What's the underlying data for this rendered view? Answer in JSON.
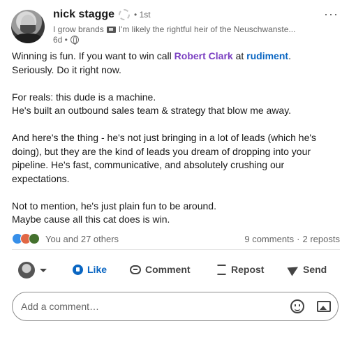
{
  "author": {
    "name": "nick stagge",
    "degree": "• 1st",
    "headline_prefix": "I grow brands",
    "headline_suffix": "I'm likely the rightful heir of the Neuschwanste...",
    "time": "6d •"
  },
  "post": {
    "line1_prefix": "Winning is fun. If you want to win call ",
    "mention_person": "Robert Clark",
    "line1_mid": " at ",
    "mention_company": "rudiment",
    "line1_suffix": ".",
    "line2": "Seriously. Do it right now.",
    "para2_line1": "For reals: this dude is a machine.",
    "para2_line2": "He's built an outbound sales team & strategy that blow me away.",
    "para3": "And here's the thing - he's not just bringing in a lot of leads (which he's doing), but they are the kind of leads you dream of dropping into your pipeline. He's fast, communicative, and absolutely crushing our expectations.",
    "para4_line1": "Not to mention, he's just plain fun to be around.",
    "para4_line2": "Maybe cause all this cat does is win."
  },
  "social": {
    "reactions_text": "You and 27 others",
    "comments": "9 comments",
    "separator": "·",
    "reposts": "2 reposts"
  },
  "actions": {
    "like": "Like",
    "comment": "Comment",
    "repost": "Repost",
    "send": "Send"
  },
  "comment_input": {
    "placeholder": "Add a comment…"
  },
  "icons": [
    "globe-icon",
    "flag-icon",
    "more-icon",
    "like-icon",
    "comment-icon",
    "repost-icon",
    "send-icon",
    "emoji-icon",
    "image-icon"
  ],
  "colors": {
    "mention_person": "#7a3fc1",
    "mention_company": "#0a66c2",
    "like_active": "#0a66c2"
  }
}
